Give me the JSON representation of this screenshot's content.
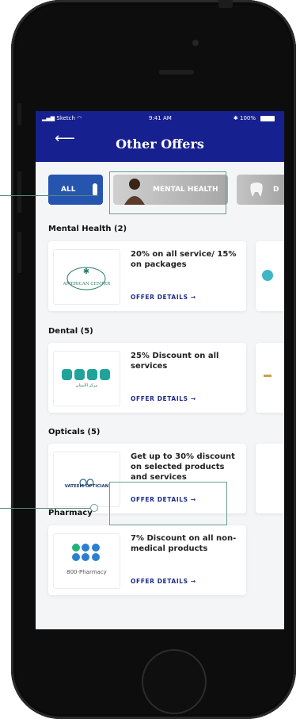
{
  "status_bar": {
    "carrier": "Sketch",
    "time": "9:41 AM",
    "battery": "100%"
  },
  "header": {
    "back_icon": "arrow-left-icon",
    "title": "Other Offers"
  },
  "filters": [
    {
      "label": "ALL"
    },
    {
      "label": "MENTAL HEALTH"
    },
    {
      "label": "D"
    }
  ],
  "sections": [
    {
      "title": "Mental Health (2)",
      "card": {
        "logo_text": "AMERICAN CENTER",
        "offer": "20% on all service/ 15% on packages",
        "link": "OFFER DETAILS →"
      }
    },
    {
      "title": "Dental (5)",
      "card": {
        "logo_text": "مركز الأسنان",
        "offer": "25% Discount on all services",
        "link": "OFFER DETAILS →"
      }
    },
    {
      "title": "Opticals (5)",
      "card": {
        "logo_text": "VATEEM OPTICIAN",
        "offer": "Get up to 30% discount on selected products and services",
        "link": "OFFER DETAILS →"
      }
    },
    {
      "title": "Pharmacy",
      "card": {
        "logo_text": "800-Pharmacy",
        "offer": "7% Discount on all non-medical products",
        "link": "OFFER DETAILS →"
      }
    }
  ],
  "colors": {
    "header": "#17208f",
    "accent": "#1b2b8a",
    "chip_all": "#2655b0"
  }
}
